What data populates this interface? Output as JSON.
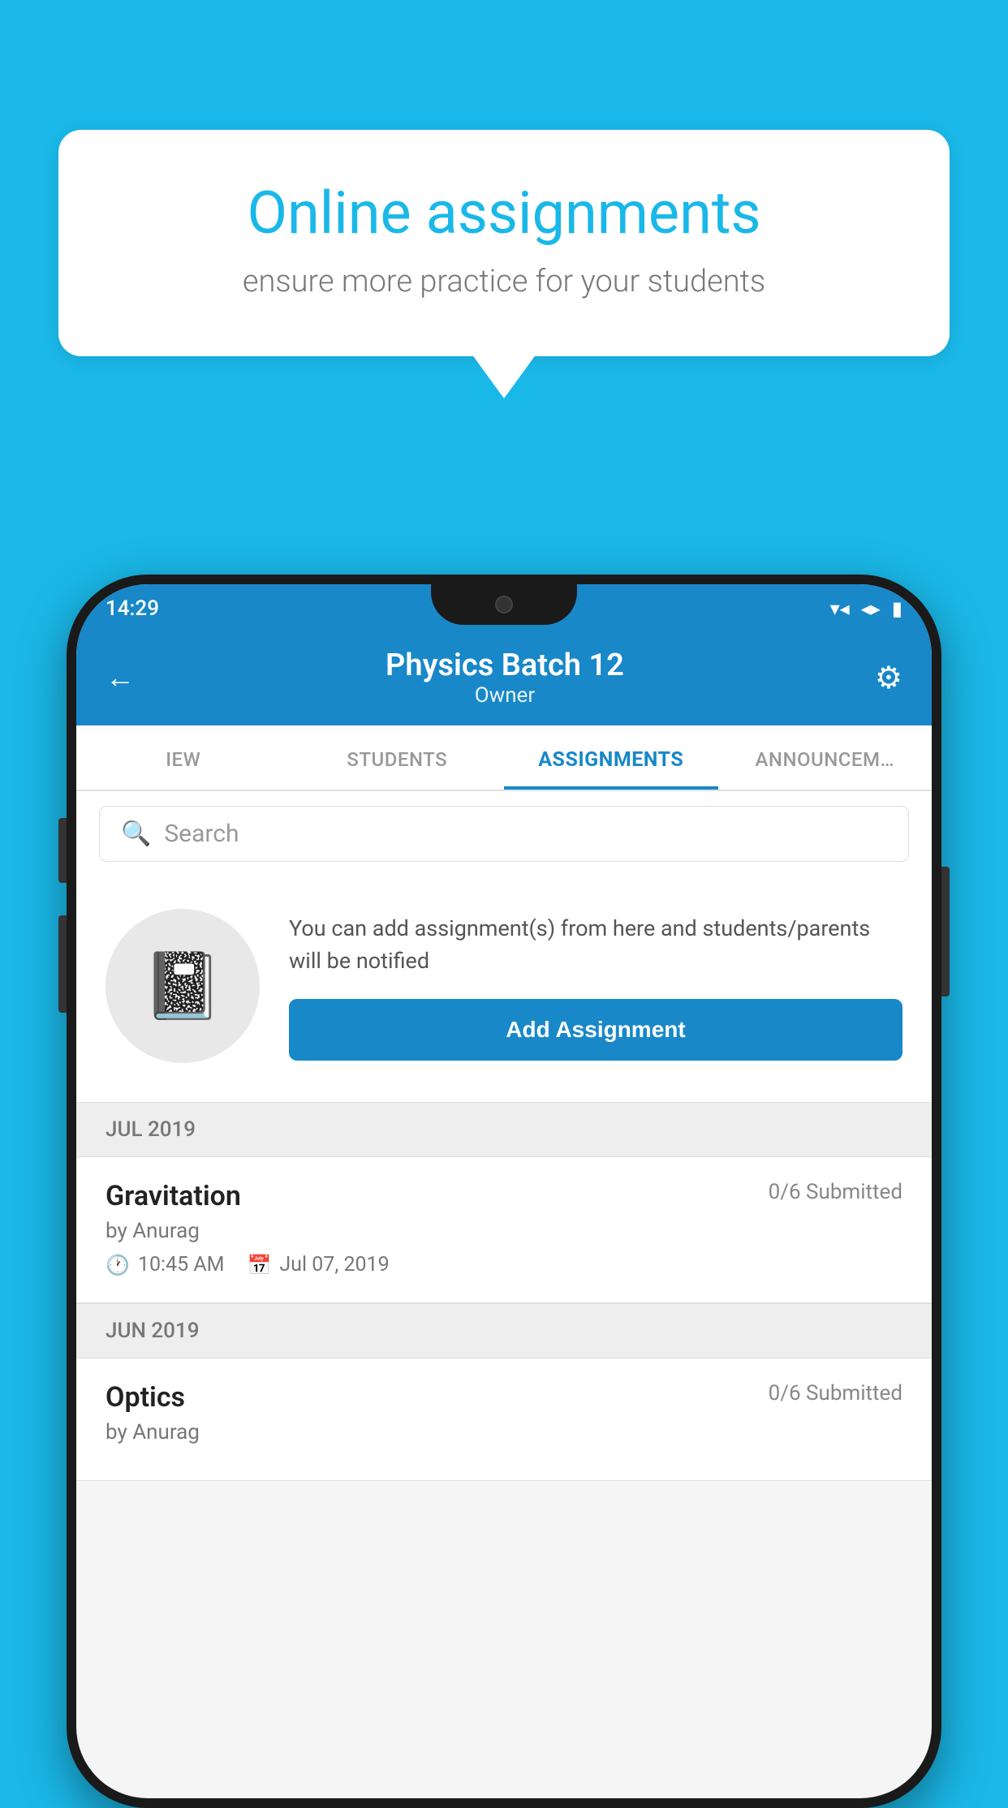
{
  "background_color": "#1ab8e8",
  "speech_bubble": {
    "title": "Online assignments",
    "subtitle": "ensure more practice for your students"
  },
  "status_bar": {
    "time": "14:29",
    "icons": [
      "wifi",
      "signal",
      "battery"
    ]
  },
  "header": {
    "title": "Physics Batch 12",
    "subtitle": "Owner",
    "back_label": "←",
    "settings_label": "⚙"
  },
  "tabs": [
    {
      "label": "IEW",
      "active": false
    },
    {
      "label": "STUDENTS",
      "active": false
    },
    {
      "label": "ASSIGNMENTS",
      "active": true
    },
    {
      "label": "ANNOUNCEM…",
      "active": false
    }
  ],
  "search": {
    "placeholder": "Search"
  },
  "add_assignment_card": {
    "description": "You can add assignment(s) from here and students/parents will be notified",
    "button_label": "Add Assignment"
  },
  "sections": [
    {
      "header": "JUL 2019",
      "assignments": [
        {
          "name": "Gravitation",
          "submitted": "0/6 Submitted",
          "by": "by Anurag",
          "time": "10:45 AM",
          "date": "Jul 07, 2019"
        }
      ]
    },
    {
      "header": "JUN 2019",
      "assignments": [
        {
          "name": "Optics",
          "submitted": "0/6 Submitted",
          "by": "by Anurag",
          "time": "",
          "date": ""
        }
      ]
    }
  ]
}
